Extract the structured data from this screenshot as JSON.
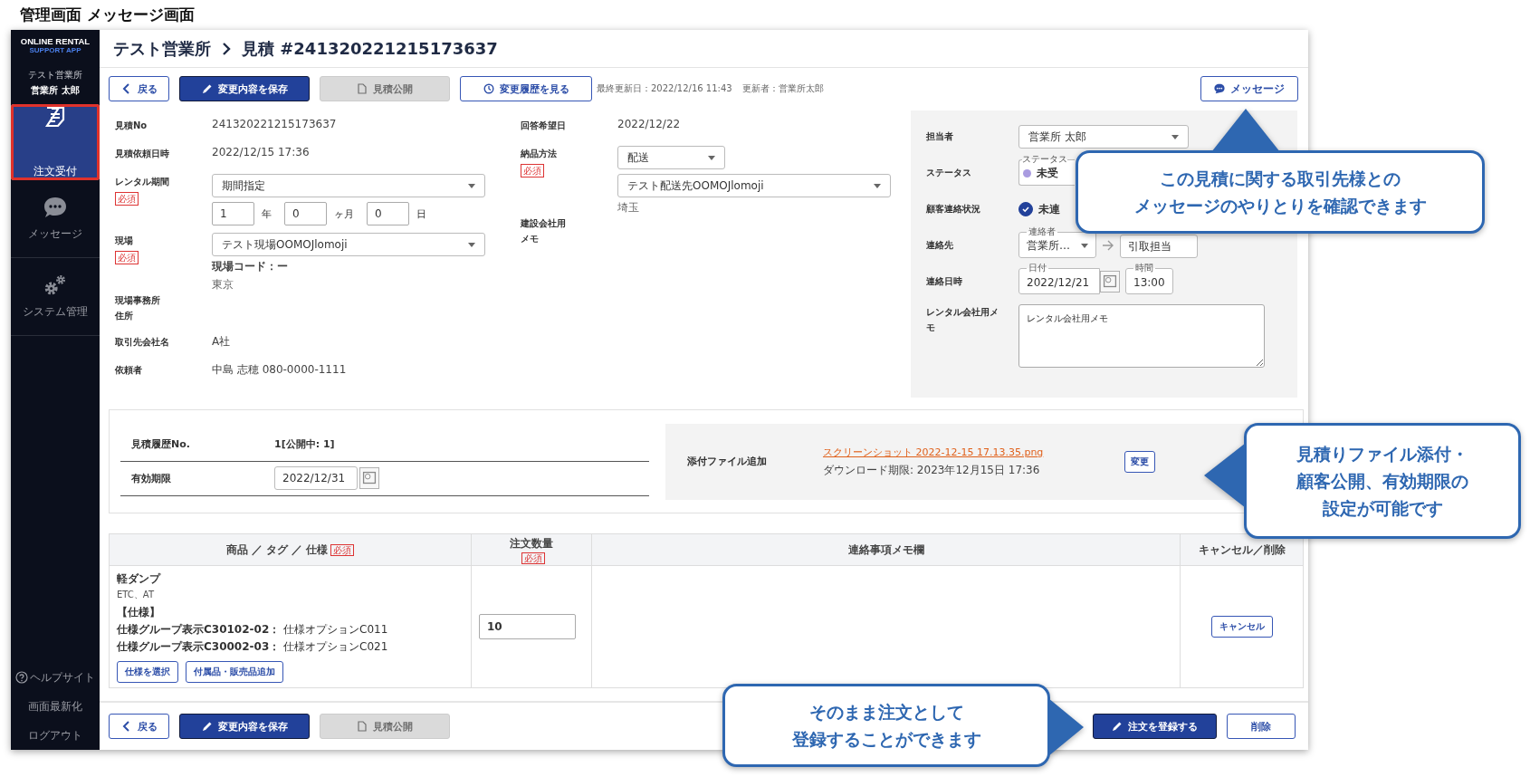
{
  "page_title": "管理画面 メッセージ画面",
  "sidebar": {
    "brand": "ONLINE RENTAL",
    "brand_sub": "SUPPORT APP",
    "office": "テスト営業所",
    "user": "営業所 太郎",
    "items": [
      {
        "label": "注文受付",
        "selected": true
      },
      {
        "label": "メッセージ",
        "selected": false
      },
      {
        "label": "システム管理",
        "selected": false
      }
    ],
    "footer_links": [
      "ヘルプサイト",
      "画面最新化",
      "ログアウト"
    ]
  },
  "header": {
    "breadcrumb": "テスト営業所",
    "title": "見積 #241320221215173637"
  },
  "toolbar": {
    "buttons": [
      {
        "label": "戻る",
        "kind": "back",
        "disabled": false
      },
      {
        "label": "変更内容を保存",
        "kind": "save",
        "disabled": false
      },
      {
        "label": "見積公開",
        "kind": "publish",
        "disabled": true
      },
      {
        "label": "変更履歴を見る",
        "kind": "history",
        "disabled": false
      }
    ],
    "last_updated": "最終更新日：2022/12/16 11:43",
    "updater": "更新者：営業所太郎",
    "message_button": "メッセージ"
  },
  "left_fields": [
    {
      "kind": "text",
      "label": [
        "見積No"
      ],
      "value": "241320221215173637"
    },
    {
      "kind": "text",
      "label": [
        "見積依頼日時"
      ],
      "value": "2022/12/15 17:36"
    },
    {
      "kind": "period",
      "label": [
        "レンタル期間"
      ],
      "required": "必須",
      "select": "期間指定",
      "years": "1",
      "year_unit": "年",
      "months": "0",
      "month_unit": "ヶ月",
      "days": "0",
      "day_unit": "日"
    },
    {
      "kind": "site",
      "label": [
        "現場"
      ],
      "required": "必須",
      "select": "テスト現場OOMOJlomoji",
      "code": "現場コード：ー",
      "area": "東京"
    },
    {
      "kind": "text",
      "label": [
        "現場事務所",
        "住所"
      ]
    },
    {
      "kind": "text",
      "label": [
        "取引先会社名"
      ],
      "value": "A社"
    },
    {
      "kind": "text",
      "label": [
        "依頼者"
      ],
      "value": "中島 志穂 080-0000-1111"
    }
  ],
  "middle_fields": [
    {
      "kind": "text",
      "label": [
        "回答希望日"
      ],
      "value": "2022/12/22"
    },
    {
      "kind": "delivery",
      "label": [
        "納品方法"
      ],
      "required": "必須",
      "method": "配送",
      "destination": "テスト配送先OOMOJlomoji",
      "area": "埼玉"
    },
    {
      "kind": "text",
      "label": [
        "建設会社用",
        "メモ"
      ]
    }
  ],
  "side_panel": {
    "assignee": {
      "label": "担当者",
      "value": "営業所 太郎"
    },
    "status": {
      "label": "ステータス",
      "field_label": "ステータス",
      "value": "未受",
      "color": "#a99be0"
    },
    "contact_status": {
      "label": "顧客連絡状況",
      "checked": true,
      "value": "未連"
    },
    "contact": {
      "label": "連絡先",
      "field_label": "連絡者",
      "from": "営業所…",
      "to": "引取担当"
    },
    "contact_date": {
      "label": "連絡日時",
      "date_label": "日付",
      "date": "2022/12/21",
      "time_label": "時間",
      "time": "13:00"
    },
    "memo": {
      "label": [
        "レンタル会社用メ",
        "モ"
      ],
      "value": "レンタル会社用メモ"
    }
  },
  "quote": {
    "history_label": "見積履歴No.",
    "history_value": "1[公開中: 1]",
    "expiry_label": "有効期限",
    "expiry": "2022/12/31",
    "attach_label": "添付ファイル追加",
    "file": "スクリーンショット 2022-12-15 17.13.35.png",
    "download_limit": "ダウンロード期限: 2023年12月15日 17:36",
    "change_button": "変更"
  },
  "table": {
    "columns": [
      {
        "label": "商品 ／ タグ ／ 仕様",
        "required": "必須"
      },
      {
        "label": "注文数量",
        "required": "必須"
      },
      {
        "label": "連絡事項メモ欄"
      },
      {
        "label": "キャンセル／削除"
      }
    ],
    "rows": [
      {
        "name": "軽ダンプ",
        "tags": "ETC、AT",
        "spec_heading": "【仕様】",
        "specs": [
          {
            "group": "仕様グループ表示C30102-02：",
            "option": "仕様オプションC011"
          },
          {
            "group": "仕様グループ表示C30002-03：",
            "option": "仕様オプションC021"
          }
        ],
        "buttons": [
          "仕様を選択",
          "付属品・販売品追加"
        ],
        "quantity": "10",
        "cancel": "キャンセル"
      }
    ]
  },
  "footer": {
    "buttons": [
      {
        "label": "戻る",
        "kind": "back",
        "disabled": false
      },
      {
        "label": "変更内容を保存",
        "kind": "save",
        "disabled": false
      },
      {
        "label": "見積公開",
        "kind": "publish",
        "disabled": true
      }
    ],
    "register_button": "注文を登録する",
    "delete_button": "削除"
  },
  "callouts": [
    {
      "lines": [
        "この見積に関する取引先様との",
        "メッセージのやりとりを確認できます"
      ],
      "kind": "up"
    },
    {
      "lines": [
        "見積りファイル添付・",
        "顧客公開、有効期限の",
        "設定が可能です"
      ],
      "kind": "left"
    },
    {
      "lines": [
        "そのまま注文として",
        "登録することができます"
      ],
      "kind": "right"
    }
  ]
}
